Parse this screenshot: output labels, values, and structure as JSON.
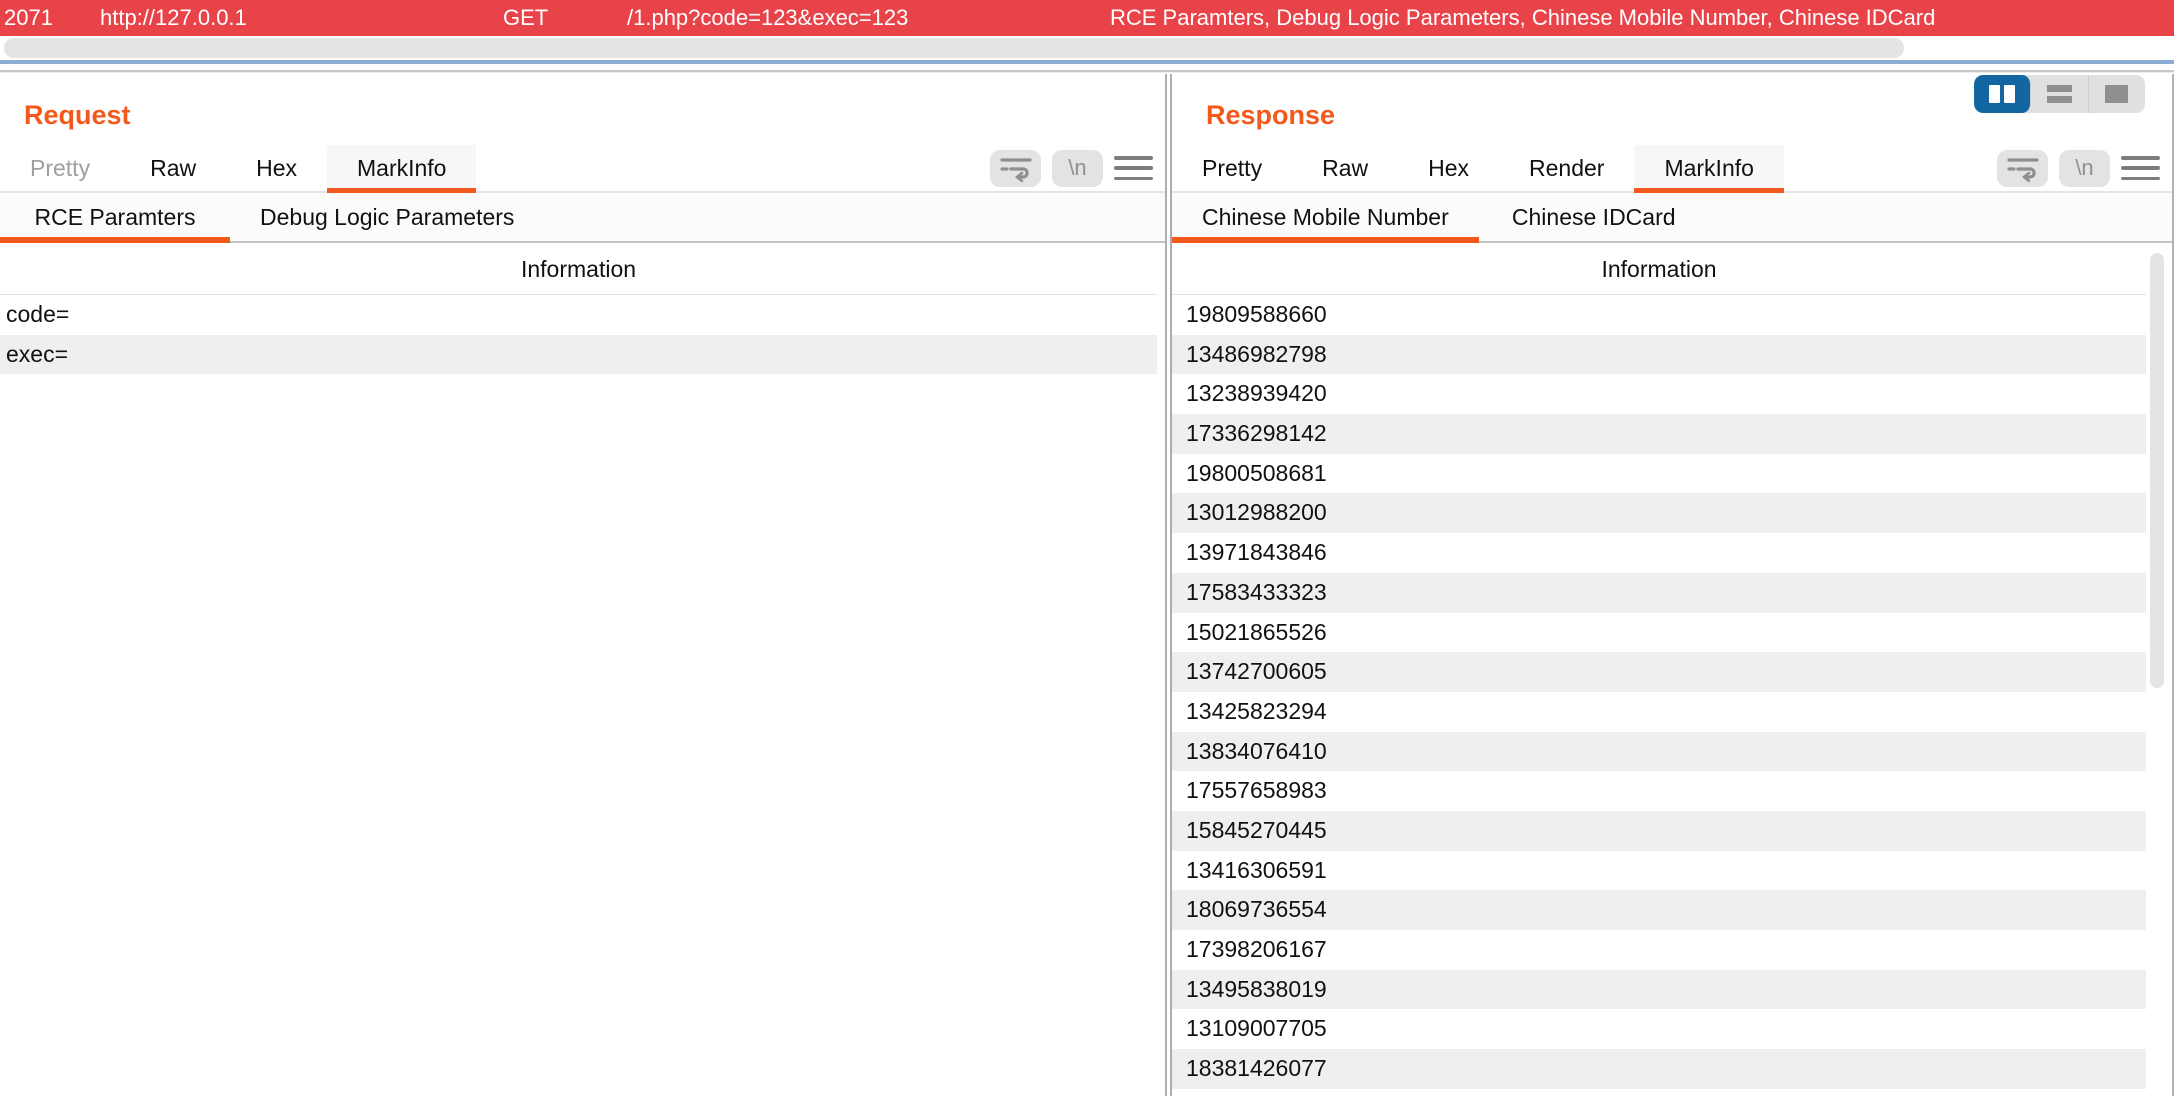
{
  "colors": {
    "selected_row_red": "#e9434a",
    "accent_orange": "#f25a1d",
    "layout_selected_blue": "#1367a0",
    "splitter_blue": "#8badd2",
    "zebra_stripe": "#efefef"
  },
  "topbar": {
    "row_id": "2071",
    "host": "http://127.0.0.1",
    "method": "GET",
    "url": "/1.php?code=123&exec=123",
    "info": "RCE Paramters, Debug Logic Parameters, Chinese Mobile Number, Chinese IDCard"
  },
  "request": {
    "title": "Request",
    "tabs": [
      {
        "label": "Pretty",
        "state": "dimmed"
      },
      {
        "label": "Raw",
        "state": "normal"
      },
      {
        "label": "Hex",
        "state": "normal"
      },
      {
        "label": "MarkInfo",
        "state": "selected"
      }
    ],
    "subtabs": [
      {
        "label": "RCE Paramters",
        "state": "selected"
      },
      {
        "label": "Debug Logic Parameters",
        "state": "normal"
      }
    ],
    "toolbar": {
      "newline_label": "\\n"
    },
    "table": {
      "header": "Information",
      "rows": [
        "code=",
        "exec="
      ]
    }
  },
  "response": {
    "title": "Response",
    "tabs": [
      {
        "label": "Pretty",
        "state": "normal"
      },
      {
        "label": "Raw",
        "state": "normal"
      },
      {
        "label": "Hex",
        "state": "normal"
      },
      {
        "label": "Render",
        "state": "normal"
      },
      {
        "label": "MarkInfo",
        "state": "selected"
      }
    ],
    "subtabs": [
      {
        "label": "Chinese Mobile Number",
        "state": "selected"
      },
      {
        "label": "Chinese IDCard",
        "state": "normal"
      }
    ],
    "toolbar": {
      "newline_label": "\\n"
    },
    "table": {
      "header": "Information",
      "rows": [
        "19809588660",
        "13486982798",
        "13238939420",
        "17336298142",
        "19800508681",
        "13012988200",
        "13971843846",
        "17583433323",
        "15021865526",
        "13742700605",
        "13425823294",
        "13834076410",
        "17557658983",
        "15845270445",
        "13416306591",
        "18069736554",
        "17398206167",
        "13495838019",
        "13109007705",
        "18381426077"
      ]
    }
  },
  "layout_toggle": {
    "options": [
      {
        "name": "two-columns-layout",
        "selected": true
      },
      {
        "name": "stacked-rows-layout",
        "selected": false
      },
      {
        "name": "single-panel-layout",
        "selected": false
      }
    ]
  }
}
